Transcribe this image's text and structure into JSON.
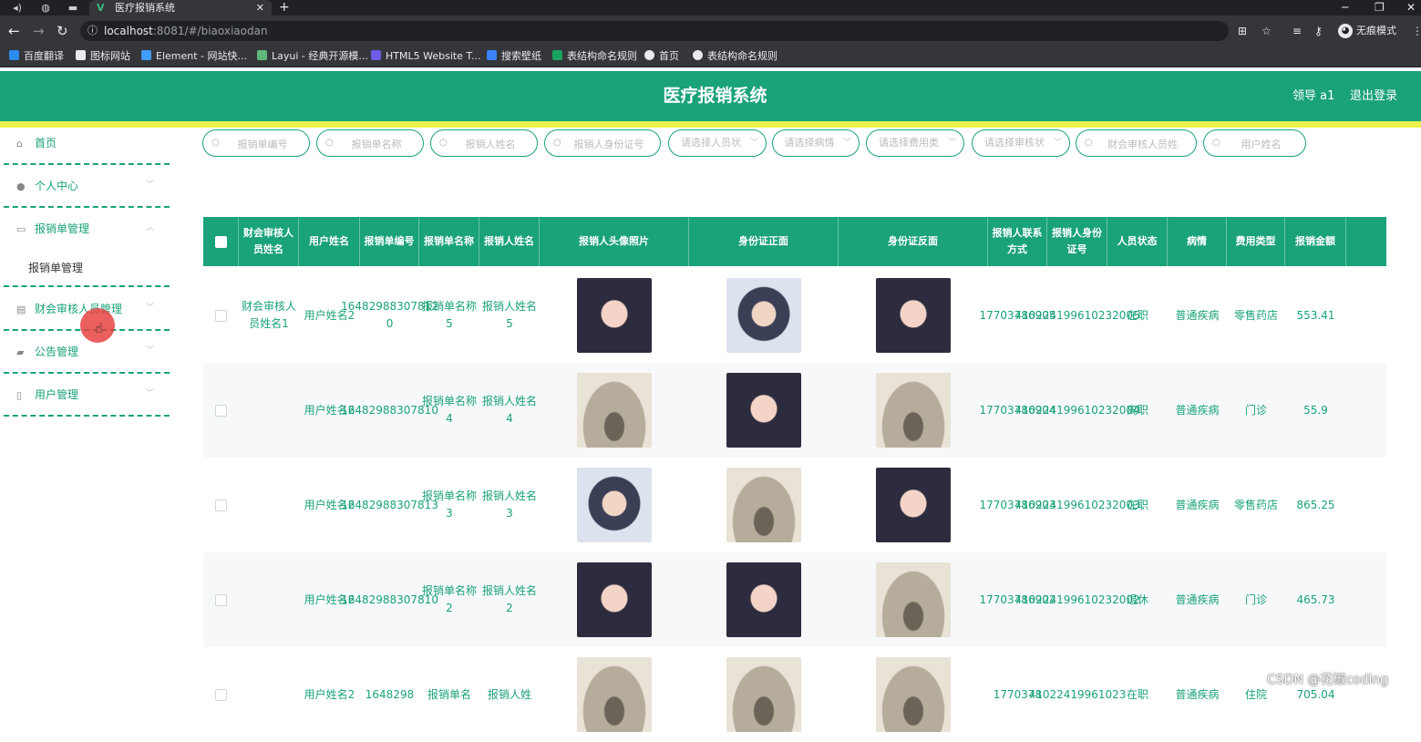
{
  "browser": {
    "tab_title": "医疗报销系统",
    "tab_favicon": "V",
    "url_host": "localhost",
    "url_rest": ":8081/#/biaoxiaodan",
    "incognito_label": "无痕模式",
    "bookmarks": [
      {
        "label": "百度翻译",
        "color": "#2d8cf0"
      },
      {
        "label": "图标网站",
        "color": "#e8eaed"
      },
      {
        "label": "Element - 网站快...",
        "color": "#409eff"
      },
      {
        "label": "Layui - 经典开源模...",
        "color": "#5fb878"
      },
      {
        "label": "HTML5 Website T...",
        "color": "#6c5ce7"
      },
      {
        "label": "搜索壁纸",
        "color": "#3b82f6"
      },
      {
        "label": "表结构命名规则",
        "color": "#1aa260"
      },
      {
        "label": "首页",
        "color": "#e8eaed"
      },
      {
        "label": "表结构命名规则",
        "color": "#e8eaed"
      }
    ]
  },
  "header": {
    "title": "医疗报销系统",
    "user": "领导 a1",
    "logout": "退出登录"
  },
  "sidebar": {
    "items": [
      {
        "label": "首页",
        "icon": "home-icon"
      },
      {
        "label": "个人中心",
        "icon": "user-icon"
      },
      {
        "label": "报销单管理",
        "icon": "message-icon"
      },
      {
        "label": "财会审核人员管理",
        "icon": "chart-icon"
      },
      {
        "label": "公告管理",
        "icon": "chat-icon"
      },
      {
        "label": "用户管理",
        "icon": "phone-icon"
      }
    ],
    "submenu_label": "报销单管理"
  },
  "search": {
    "inputs": [
      {
        "placeholder": "报销单编号"
      },
      {
        "placeholder": "报销单名称"
      },
      {
        "placeholder": "报销人姓名"
      },
      {
        "placeholder": "报销人身份证号"
      }
    ],
    "selects": [
      {
        "label": "请选择人员状"
      },
      {
        "label": "请选择病情"
      },
      {
        "label": "请选择费用类"
      },
      {
        "label": "请选择审核状"
      }
    ],
    "inputs2": [
      {
        "placeholder": "财会审核人员姓"
      },
      {
        "placeholder": "用户姓名"
      }
    ]
  },
  "table": {
    "columns": [
      "财会审核人员姓名",
      "用户姓名",
      "报销单编号",
      "报销单名称",
      "报销人姓名",
      "报销人头像照片",
      "身份证正面",
      "身份证反面",
      "报销人联系方式",
      "报销人身份证号",
      "人员状态",
      "病情",
      "费用类型",
      "报销金额"
    ],
    "rows": [
      {
        "auditor": "财会审核人员姓名1",
        "user": "用户姓名2",
        "no": "16482988307812 0",
        "name": "报销单名称5",
        "person": "报销人姓名5",
        "photo": "ph-a",
        "idf": "ph-c",
        "idb": "ph-a",
        "phone": "17703786905",
        "idno": "410224199610232005",
        "status": "在职",
        "illness": "普通疾病",
        "fee": "零售药店",
        "amount": "553.41"
      },
      {
        "auditor": "",
        "user": "用户姓名2",
        "no": "16482988307810",
        "name": "报销单名称4",
        "person": "报销人姓名4",
        "photo": "ph-b",
        "idf": "ph-a",
        "idb": "ph-b",
        "phone": "17703786904",
        "idno": "410224199610232004",
        "status": "离职",
        "illness": "普通疾病",
        "fee": "门诊",
        "amount": "55.9"
      },
      {
        "auditor": "",
        "user": "用户姓名2",
        "no": "16482988307813",
        "name": "报销单名称3",
        "person": "报销人姓名3",
        "photo": "ph-c",
        "idf": "ph-b",
        "idb": "ph-a",
        "phone": "17703786903",
        "idno": "410224199610232003",
        "status": "在职",
        "illness": "普通疾病",
        "fee": "零售药店",
        "amount": "865.25"
      },
      {
        "auditor": "",
        "user": "用户姓名2",
        "no": "16482988307810",
        "name": "报销单名称2",
        "person": "报销人姓名2",
        "photo": "ph-a",
        "idf": "ph-a",
        "idb": "ph-b",
        "phone": "17703786902",
        "idno": "410224199610232002",
        "status": "退休",
        "illness": "普通疾病",
        "fee": "门诊",
        "amount": "465.73"
      },
      {
        "auditor": "",
        "user": "用户姓名2",
        "no": "1648298",
        "name": "报销单名",
        "person": "报销人姓",
        "photo": "ph-b",
        "idf": "ph-b",
        "idb": "ph-b",
        "phone": "1770378",
        "idno": "41022419961023",
        "status": "在职",
        "illness": "普通疾病",
        "fee": "住院",
        "amount": "705.04"
      }
    ]
  },
  "watermark": "CSDN @花椒coding",
  "colors": {
    "primary": "#1aa27a",
    "accent_line": "#ecf24c",
    "cursor": "#e63c3c"
  }
}
